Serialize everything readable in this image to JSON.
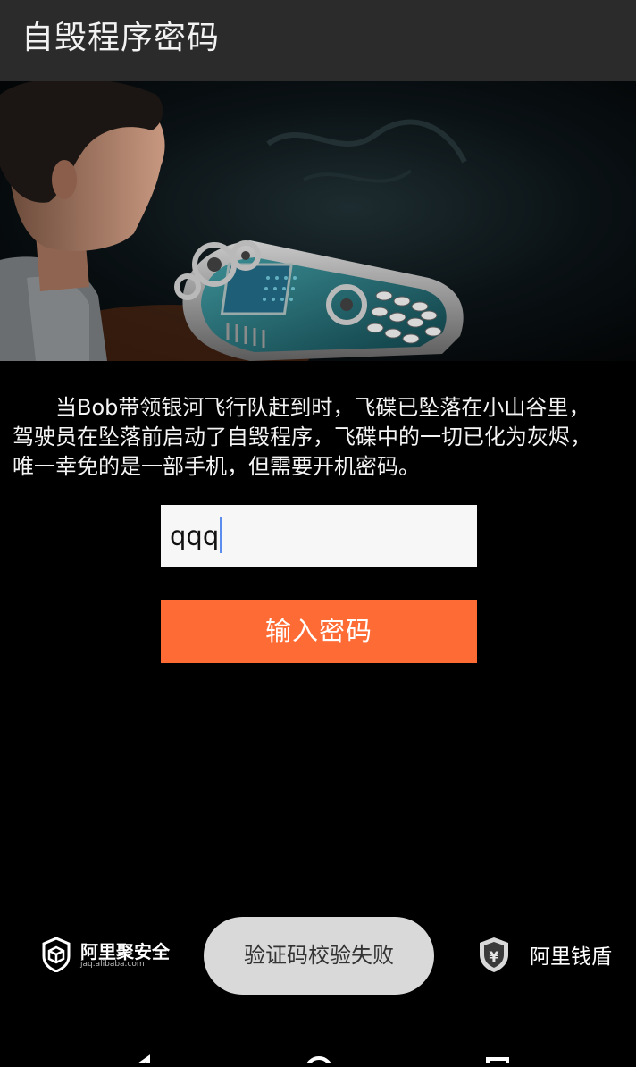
{
  "app": {
    "title": "自毁程序密码"
  },
  "story": {
    "text": "当Bob带领银河飞行队赶到时，飞碟已坠落在小山谷里，驾驶员在坠落前启动了自毁程序，飞碟中的一切已化为灰烬，唯一幸免的是一部手机，但需要开机密码。"
  },
  "form": {
    "password_value": "qqq",
    "submit_label": "输入密码"
  },
  "footer": {
    "left_logo_name": "阿里聚安全",
    "left_logo_url": "jaq.alibaba.com",
    "right_logo_name": "阿里钱盾"
  },
  "toast": {
    "message": "验证码校验失败"
  },
  "colors": {
    "action_bar": "#2b2b2b",
    "button": "#ff6b35",
    "input_bg": "#f7f7f7",
    "toast_bg": "#d9d9d9",
    "caret": "#5a8dee"
  },
  "icons": {
    "left_logo": "shield-box-icon",
    "right_logo": "shield-yen-icon",
    "nav_back": "back-triangle-icon",
    "nav_home": "home-circle-icon",
    "nav_recents": "recents-square-icon"
  }
}
